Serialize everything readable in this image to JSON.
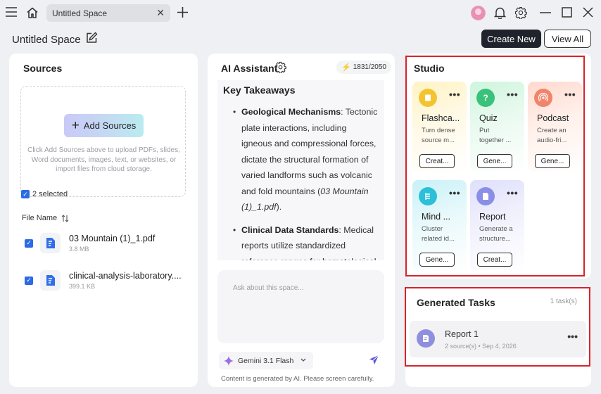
{
  "window": {
    "tab_title": "Untitled Space",
    "icons": [
      "menu-icon",
      "home-icon",
      "close-icon",
      "plus-icon",
      "bell-icon",
      "gear-icon",
      "minimize-icon",
      "maximize-icon",
      "close-icon"
    ]
  },
  "header": {
    "space_title": "Untitled Space",
    "create_new_label": "Create New",
    "view_all_label": "View All"
  },
  "sources": {
    "title": "Sources",
    "add_sources_label": "Add Sources",
    "hint": "Click Add Sources above to upload PDFs, slides, Word documents, images, text, or websites, or import files from cloud storage.",
    "selected_label": "2 selected",
    "file_name_header": "File Name",
    "files": [
      {
        "name": "03 Mountain (1)_1.pdf",
        "size": "3.8 MB",
        "checked": true
      },
      {
        "name": "clinical-analysis-laboratory....",
        "size": "399.1 KB",
        "checked": true
      }
    ]
  },
  "ai": {
    "title": "AI Assistant",
    "tokens": "1831/2050",
    "heading": "Key Takeaways",
    "bullets": [
      {
        "bold": "Geological Mechanisms",
        "text": ": Tectonic plate interactions, including igneous and compressional forces, dictate the structural formation of varied landforms such as volcanic and fold mountains (",
        "italic": "03 Mountain (1)_1.pdf",
        "tail": ")."
      },
      {
        "bold": "Clinical Data Standards",
        "text": ": Medical reports utilize standardized reference ranges for hematological metrics to",
        "italic": "",
        "tail": ""
      }
    ],
    "ask_placeholder": "Ask about this space...",
    "model": "Gemini 3.1 Flash",
    "disclaimer": "Content is generated by AI. Please screen carefully."
  },
  "studio": {
    "title": "Studio",
    "cards": [
      {
        "title": "Flashca...",
        "desc1": "Turn dense",
        "desc2": "source m...",
        "button": "Creat...",
        "icon": "flashcard-icon",
        "color": "#f4c430"
      },
      {
        "title": "Quiz",
        "desc1": "Put",
        "desc2": "together ...",
        "button": "Gene...",
        "icon": "quiz-icon",
        "color": "#38c27a"
      },
      {
        "title": "Podcast",
        "desc1": "Create an",
        "desc2": "audio-fri...",
        "button": "Gene...",
        "icon": "podcast-icon",
        "color": "#f0856b"
      },
      {
        "title": "Mind ...",
        "desc1": "Cluster",
        "desc2": "related id...",
        "button": "Gene...",
        "icon": "mindmap-icon",
        "color": "#2bbfd9"
      },
      {
        "title": "Report",
        "desc1": "Generate a",
        "desc2": "structure...",
        "button": "Creat...",
        "icon": "report-icon",
        "color": "#8a8ee6"
      }
    ]
  },
  "tasks": {
    "title": "Generated Tasks",
    "count": "1 task(s)",
    "items": [
      {
        "name": "Report 1",
        "meta": "2 source(s) • Sep 4, 2026"
      }
    ]
  }
}
